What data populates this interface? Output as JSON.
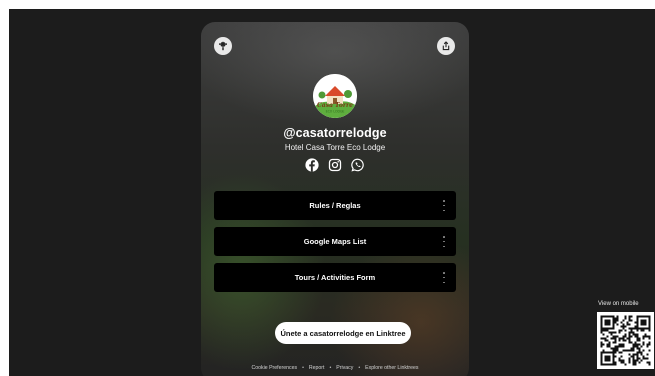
{
  "profile": {
    "username": "@casatorrelodge",
    "bio": "Hotel Casa Torre Eco Lodge",
    "avatar_text_line1": "Casa Torre",
    "avatar_text_line2": "ECO LODGE"
  },
  "header": {
    "left_icon": "linktree-asterisk-icon",
    "right_icon": "share-icon"
  },
  "socials": [
    {
      "name": "facebook",
      "icon": "facebook-icon"
    },
    {
      "name": "instagram",
      "icon": "instagram-icon"
    },
    {
      "name": "whatsapp",
      "icon": "whatsapp-icon"
    }
  ],
  "links": [
    {
      "label": "Rules / Reglas"
    },
    {
      "label": "Google Maps List"
    },
    {
      "label": "Tours / Activities Form"
    }
  ],
  "cta": {
    "label": "Únete a casatorrelodge en Linktree"
  },
  "footer": {
    "items": [
      "Cookie Preferences",
      "Report",
      "Privacy",
      "Explore other Linktrees"
    ],
    "separator": "•"
  },
  "mobile": {
    "label": "View on mobile"
  },
  "colors": {
    "page_background": "#1c1c1c",
    "link_background": "#000000",
    "text": "#ffffff",
    "cta_background": "#ffffff"
  }
}
